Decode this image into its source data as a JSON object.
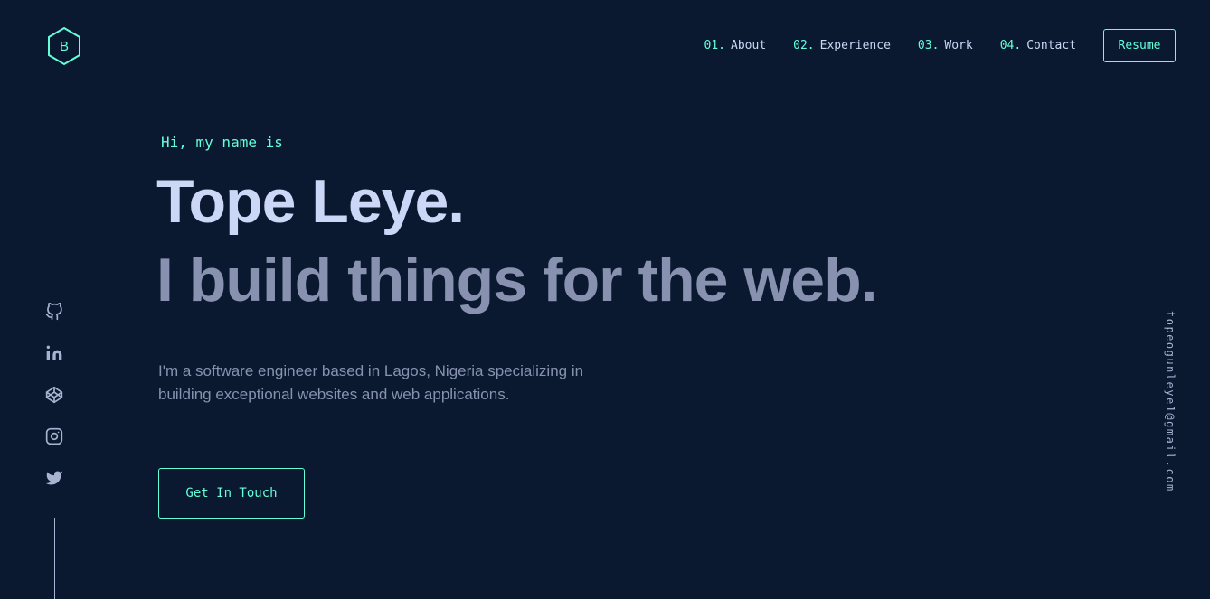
{
  "logo": {
    "letter": "B",
    "icon": "hexagon-logo-icon"
  },
  "nav": {
    "items": [
      {
        "num": "01.",
        "label": "About"
      },
      {
        "num": "02.",
        "label": "Experience"
      },
      {
        "num": "03.",
        "label": "Work"
      },
      {
        "num": "04.",
        "label": "Contact"
      }
    ],
    "resume_label": "Resume"
  },
  "hero": {
    "greeting": "Hi, my name is",
    "name": "Tope Leye.",
    "tagline": "I build things for the web.",
    "description": "I'm a software engineer based in Lagos, Nigeria specializing in building exceptional websites and web applications.",
    "cta_label": "Get In Touch"
  },
  "social": [
    {
      "icon": "github-icon"
    },
    {
      "icon": "linkedin-icon"
    },
    {
      "icon": "codepen-icon"
    },
    {
      "icon": "instagram-icon"
    },
    {
      "icon": "twitter-icon"
    }
  ],
  "email": "topeogunleye1@gmail.com",
  "colors": {
    "background": "#0a192f",
    "accent": "#64ffda",
    "heading": "#ccd6f6",
    "body_text": "#8892b0",
    "light_slate": "#a8b2d1"
  }
}
